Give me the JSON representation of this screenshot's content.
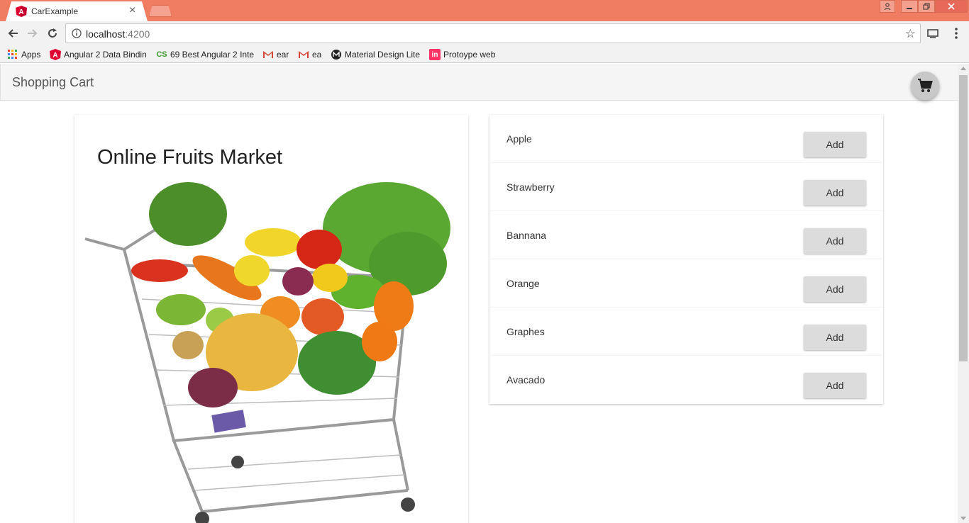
{
  "browser": {
    "tab_title": "CarExample",
    "tab_close": "×",
    "url_host": "localhost",
    "url_port": ":4200",
    "bookmarks": [
      {
        "label": "Apps",
        "icon": "apps-grid-icon"
      },
      {
        "label": "Angular 2 Data Bindin",
        "icon": "angular-icon"
      },
      {
        "label": "69 Best Angular 2 Inte",
        "icon": "cs-icon"
      },
      {
        "label": "ear",
        "icon": "gmail-icon"
      },
      {
        "label": "ea",
        "icon": "gmail-icon"
      },
      {
        "label": "Material Design Lite",
        "icon": "mdl-icon"
      },
      {
        "label": "Protoype web",
        "icon": "invision-icon"
      }
    ]
  },
  "app": {
    "title": "Shopping Cart",
    "hero_title": "Online Fruits Market",
    "add_label": "Add",
    "fruits": [
      "Apple",
      "Strawberry",
      "Bannana",
      "Orange",
      "Graphes",
      "Avacado"
    ]
  },
  "colors": {
    "tabstrip": "#f07d62",
    "button": "#dcdcdc",
    "angular_red": "#dd0031"
  }
}
